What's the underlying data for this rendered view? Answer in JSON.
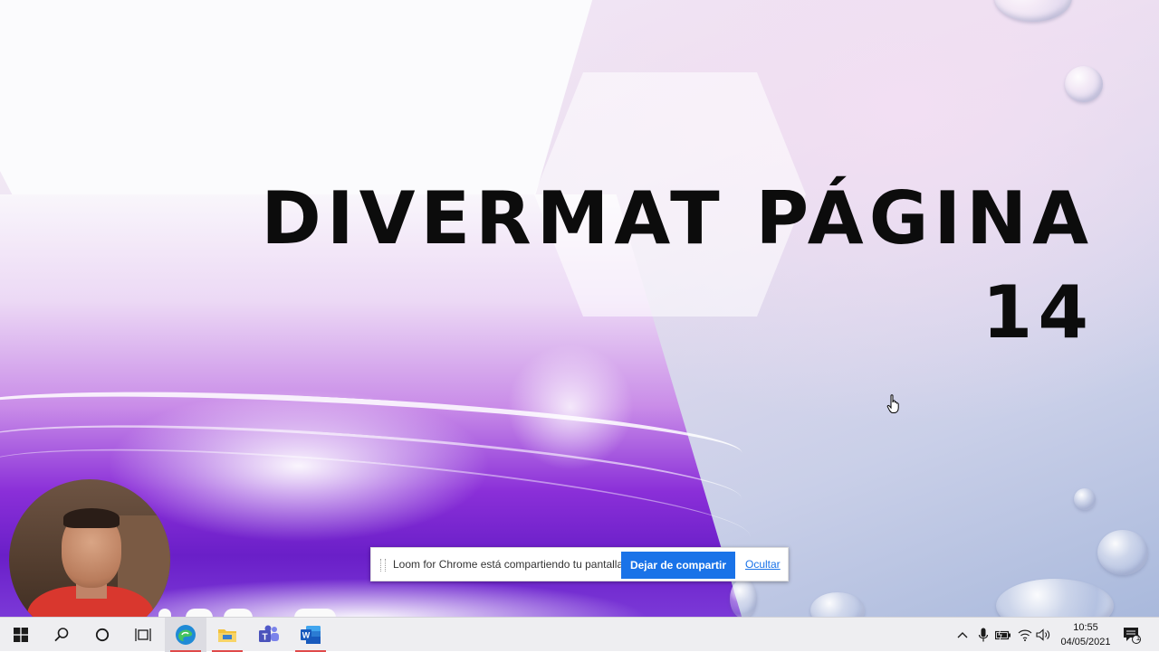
{
  "slide": {
    "title_line1": "DIVERMAT PÁGINA",
    "title_line2": "14"
  },
  "loom_bar": {
    "message": "Loom for Chrome está compartiendo tu pantalla.",
    "stop_label": "Dejar de compartir",
    "hide_label": "Ocultar"
  },
  "taskbar": {
    "apps": [
      "windows-start-icon",
      "search-icon",
      "cortana-icon",
      "task-view-icon",
      "edge-icon",
      "file-explorer-icon",
      "teams-icon",
      "word-icon"
    ],
    "tray": [
      "chevron-up-icon",
      "microphone-icon",
      "battery-icon",
      "wifi-icon",
      "volume-icon"
    ],
    "time": "10:55",
    "date": "04/05/2021",
    "notification_count": "1"
  },
  "colors": {
    "loom_accent": "#1a73e8",
    "title": "#0c0c0c",
    "slide_purple": "#8a2fd8"
  }
}
